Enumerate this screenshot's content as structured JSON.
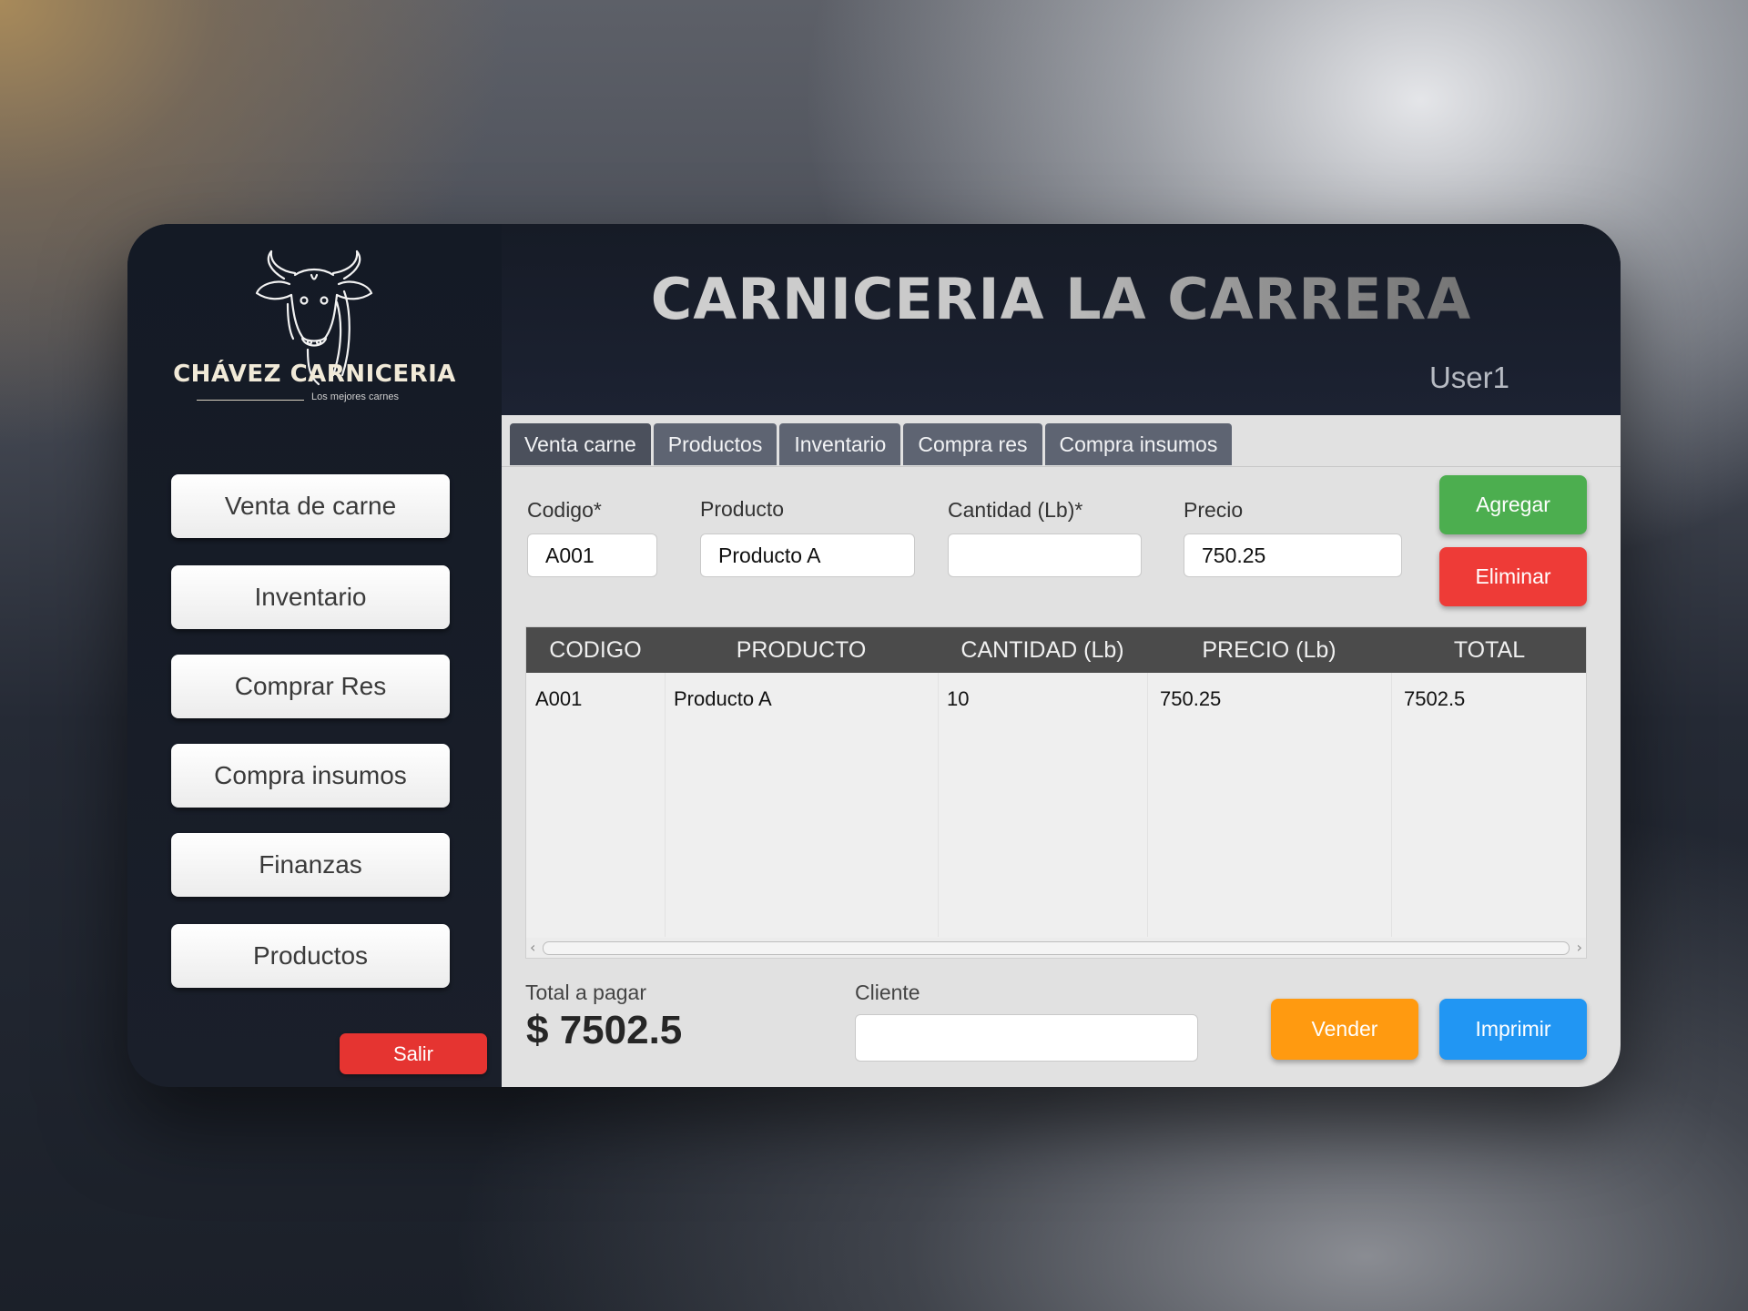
{
  "brand": {
    "name": "CHÁVEZ CARNICERIA",
    "tagline": "Los mejores carnes"
  },
  "sidebar": {
    "items": [
      {
        "label": "Venta de carne"
      },
      {
        "label": "Inventario"
      },
      {
        "label": "Comprar Res"
      },
      {
        "label": "Compra insumos"
      },
      {
        "label": "Finanzas"
      },
      {
        "label": "Productos"
      }
    ],
    "exit_label": "Salir"
  },
  "header": {
    "title": "CARNICERIA LA CARRERA",
    "user": "User1"
  },
  "tabs": [
    {
      "label": "Venta carne",
      "active": true
    },
    {
      "label": "Productos",
      "active": false
    },
    {
      "label": "Inventario",
      "active": false
    },
    {
      "label": "Compra res",
      "active": false
    },
    {
      "label": "Compra insumos",
      "active": false
    }
  ],
  "form": {
    "codigo": {
      "label": "Codigo*",
      "value": "A001"
    },
    "producto": {
      "label": "Producto",
      "value": "Producto A"
    },
    "cantidad": {
      "label": "Cantidad (Lb)*",
      "value": ""
    },
    "precio": {
      "label": "Precio",
      "value": "750.25"
    },
    "add_label": "Agregar",
    "delete_label": "Eliminar"
  },
  "table": {
    "columns": [
      "CODIGO",
      "PRODUCTO",
      "CANTIDAD (Lb)",
      "PRECIO (Lb)",
      "TOTAL"
    ],
    "rows": [
      [
        "A001",
        "Producto A",
        "10",
        "750.25",
        "7502.5"
      ]
    ]
  },
  "footer": {
    "total_label": "Total a pagar",
    "total_value": "$ 7502.5",
    "cliente_label": "Cliente",
    "cliente_value": "",
    "sell_label": "Vender",
    "print_label": "Imprimir"
  },
  "colors": {
    "add": "#4cae4f",
    "delete": "#ee3b37",
    "sell": "#ff9a10",
    "print": "#2196f3",
    "exit": "#e53431"
  }
}
